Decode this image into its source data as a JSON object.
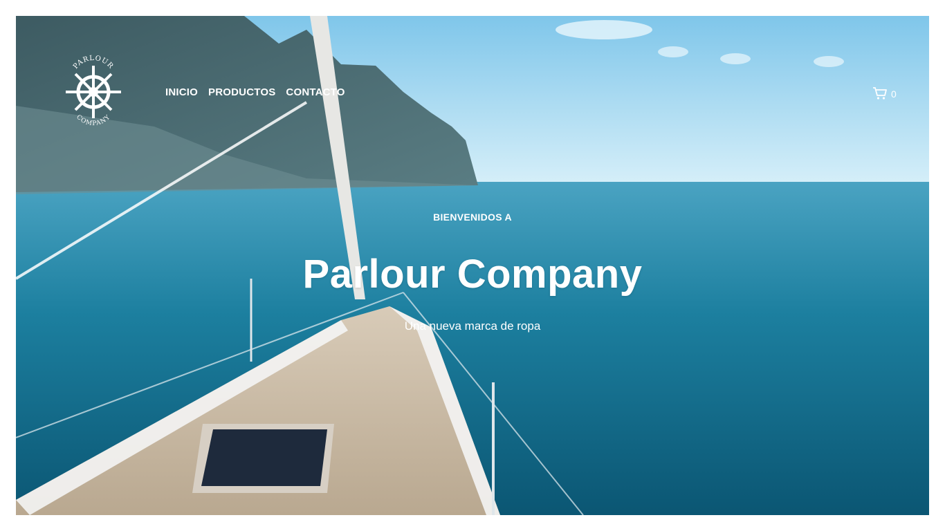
{
  "header": {
    "logo_text_top": "PARLOUR",
    "logo_text_bottom": "COMPANY",
    "nav": [
      {
        "label": "INICIO"
      },
      {
        "label": "PRODUCTOS"
      },
      {
        "label": "CONTACTO"
      }
    ],
    "cart_icon": "shopping-cart-icon",
    "cart_count": "0"
  },
  "hero": {
    "eyebrow": "BIENVENIDOS A",
    "title": "Parlour Company",
    "subtitle": "Una nueva marca de ropa",
    "background": "sailboat-bow-on-blue-sea-photo"
  },
  "colors": {
    "text": "#ffffff",
    "sea": "#1a7a98",
    "sky": "#bfe6f7",
    "deck": "#c9b9a4"
  }
}
